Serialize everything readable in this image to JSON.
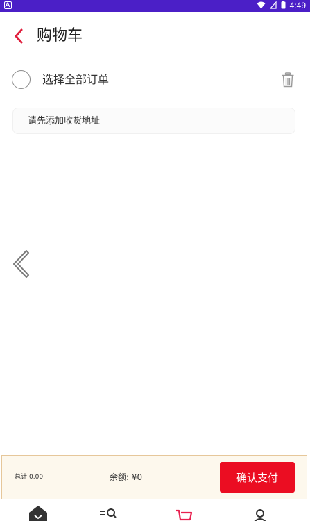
{
  "status_bar": {
    "time": "4:49",
    "icons": [
      "app-notification-icon",
      "wifi-icon",
      "signal-icon",
      "battery-icon"
    ]
  },
  "header": {
    "title": "购物车",
    "back_icon": "chevron-left-icon"
  },
  "cart": {
    "select_all_label": "选择全部订单",
    "delete_icon": "trash-icon",
    "address_prompt": "请先添加收货地址"
  },
  "checkout": {
    "total_label": "总计:0.00",
    "balance_label": "余额: ¥0",
    "confirm_button": "确认支付"
  },
  "bottom_nav": {
    "items": [
      {
        "icon": "home-icon"
      },
      {
        "icon": "category-search-icon"
      },
      {
        "icon": "cart-icon",
        "active": true
      },
      {
        "icon": "profile-icon"
      }
    ]
  },
  "colors": {
    "status_bar": "#4b1fc7",
    "accent": "#eb0d22",
    "nav_active": "#e8204f",
    "checkout_bg": "#fdf8ed",
    "checkout_border": "#e6c79a"
  }
}
